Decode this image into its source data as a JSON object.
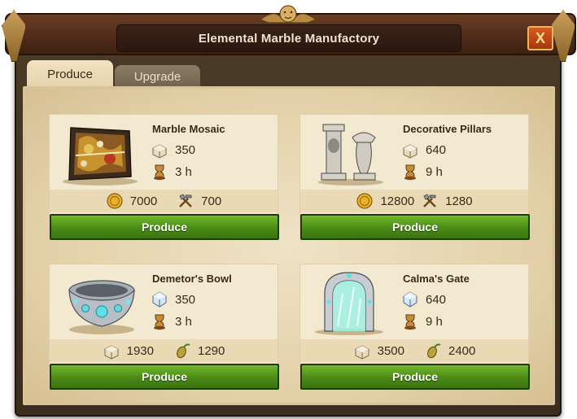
{
  "window": {
    "title": "Elemental Marble Manufactory",
    "close_label": "X"
  },
  "tabs": [
    {
      "label": "Produce",
      "active": true
    },
    {
      "label": "Upgrade",
      "active": false
    }
  ],
  "goods": [
    {
      "name": "Marble Mosaic",
      "resource_icon": "marble-icon",
      "resource_amount": "350",
      "time": "3 h",
      "cost_1_icon": "coin-icon",
      "cost_1": "7000",
      "cost_2_icon": "tools-icon",
      "cost_2": "700",
      "button": "Produce"
    },
    {
      "name": "Decorative Pillars",
      "resource_icon": "marble-icon",
      "resource_amount": "640",
      "time": "9 h",
      "cost_1_icon": "coin-icon",
      "cost_1": "12800",
      "cost_2_icon": "tools-icon",
      "cost_2": "1280",
      "button": "Produce"
    },
    {
      "name": "Demetor's Bowl",
      "resource_icon": "crystal-icon",
      "resource_amount": "350",
      "time": "3 h",
      "cost_1_icon": "marble-icon",
      "cost_1": "1930",
      "cost_2_icon": "seed-icon",
      "cost_2": "1290",
      "button": "Produce"
    },
    {
      "name": "Calma's Gate",
      "resource_icon": "crystal-icon",
      "resource_amount": "640",
      "time": "9 h",
      "cost_1_icon": "marble-icon",
      "cost_1": "3500",
      "cost_2_icon": "seed-icon",
      "cost_2": "2400",
      "button": "Produce"
    }
  ],
  "colors": {
    "button_green": "#4a8a16",
    "panel_bg": "#efe3c6",
    "frame_brown": "#4e2a18",
    "close_orange": "#d75a22"
  }
}
